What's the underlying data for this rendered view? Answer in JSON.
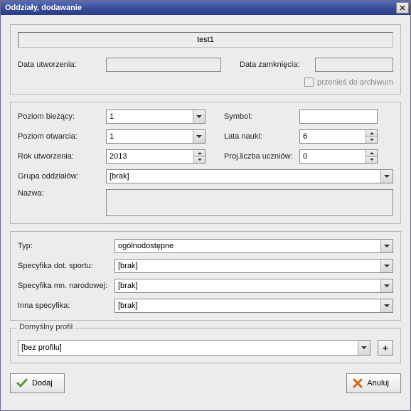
{
  "window": {
    "title": "Oddziały, dodawanie"
  },
  "header": {
    "title_value": "test1",
    "data_utworzenia_label": "Data utworzenia:",
    "data_utworzenia_value": "",
    "data_zamkniecia_label": "Data zamknięcia:",
    "data_zamkniecia_value": "",
    "archive_label": "przenieś do archiwum",
    "archive_checked": false
  },
  "main": {
    "poziom_biezacy_label": "Poziom bieżący:",
    "poziom_biezacy_value": "1",
    "symbol_label": "Symbol:",
    "symbol_value": "",
    "poziom_otwarcia_label": "Poziom otwarcia:",
    "poziom_otwarcia_value": "1",
    "lata_nauki_label": "Lata nauki:",
    "lata_nauki_value": "6",
    "rok_utworzenia_label": "Rok utworzenia:",
    "rok_utworzenia_value": "2013",
    "proj_liczba_label": "Proj.liczba uczniów:",
    "proj_liczba_value": "0",
    "grupa_oddzialow_label": "Grupa oddziałów:",
    "grupa_oddzialow_value": "[brak]",
    "nazwa_label": "Nazwa:",
    "nazwa_value": ""
  },
  "type_section": {
    "typ_label": "Typ:",
    "typ_value": "ogólnodostępne",
    "spec_sport_label": "Specyfika dot. sportu:",
    "spec_sport_value": "[brak]",
    "spec_mn_label": "Specyfika mn. narodowej:",
    "spec_mn_value": "[brak]",
    "inna_spec_label": "Inna specyfika:",
    "inna_spec_value": "[brak]"
  },
  "profile": {
    "legend": "Domyślny profil",
    "value": "[bez profilu]"
  },
  "buttons": {
    "add_label": "Dodaj",
    "cancel_label": "Anuluj"
  }
}
